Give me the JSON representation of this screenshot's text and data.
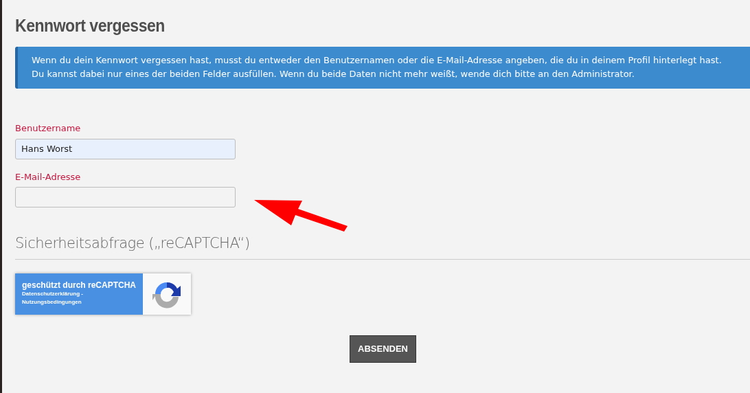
{
  "title": "Kennwort vergessen",
  "alert": {
    "lines": [
      "Wenn du dein Kennwort vergessen hast, musst du entweder den Benutzernamen oder die E-Mail-Adresse angeben, die du in deinem Profil hinterlegt hast.",
      "Du kannst dabei nur eines der beiden Felder ausfüllen. Wenn du beide Daten nicht mehr weißt, wende dich bitte an den Administrator."
    ]
  },
  "fields": [
    {
      "label": "Benutzername",
      "value": "Hans Worst"
    },
    {
      "label": "E-Mail-Adresse"
    }
  ],
  "section_heading": "Sicherheitsabfrage („reCAPTCHA“)",
  "recaptcha": {
    "title": "geschützt durch reCAPTCHA",
    "privacy_link": "Datenschutzerklärung -",
    "terms_link": "Nutzungsbedingungen"
  },
  "submit_button": "ABSENDEN"
}
